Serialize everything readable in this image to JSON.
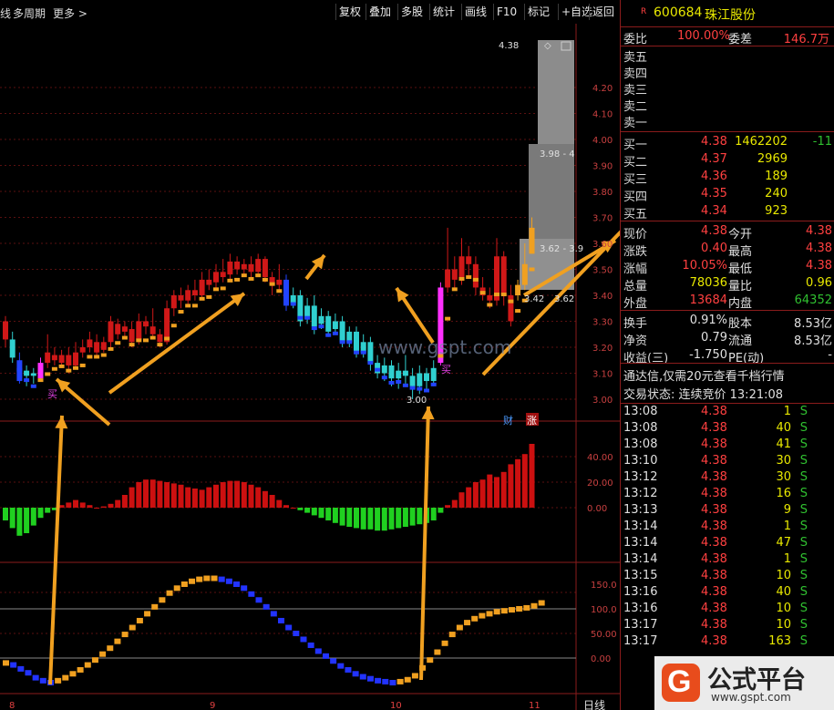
{
  "toolbar": {
    "left_items": [
      "线",
      "多周期",
      "更多 >"
    ],
    "buttons": [
      "复权",
      "叠加",
      "多股",
      "统计",
      "画线",
      "F10",
      "标记",
      "+自选",
      "返回"
    ]
  },
  "chart": {
    "price_ticks": [
      "4.20",
      "4.10",
      "4.00",
      "3.90",
      "3.80",
      "3.70",
      "3.60",
      "3.50",
      "3.40",
      "3.30",
      "3.20",
      "3.10",
      "3.00"
    ],
    "top_price_label": "4.38",
    "low_price_label": "3.00",
    "box_labels": [
      "3.98 - 4",
      "3.62 - 3.9",
      "3.42",
      "3.62"
    ],
    "buy_marker": "买",
    "badges": [
      "财",
      "涨"
    ],
    "watermark": "www.gspt.com",
    "macd_ticks": [
      "40.00",
      "20.00",
      "0.00"
    ],
    "osc_ticks": [
      "150.0",
      "100.0",
      "50.00",
      "0.00"
    ],
    "x_labels": [
      "8",
      "9",
      "10",
      "11"
    ],
    "x_axis_mode": "日线"
  },
  "panel": {
    "badge": "R",
    "code": "600684",
    "name": "珠江股份",
    "weibi_label": "委比",
    "weibi_value": "100.00%",
    "weicha_label": "委差",
    "weicha_value": "146.7万",
    "sell_levels": [
      "卖五",
      "卖四",
      "卖三",
      "卖二",
      "卖一"
    ],
    "buy_levels": [
      {
        "label": "买一",
        "price": "4.38",
        "vol": "1462202",
        "chg": "-11"
      },
      {
        "label": "买二",
        "price": "4.37",
        "vol": "2969",
        "chg": ""
      },
      {
        "label": "买三",
        "price": "4.36",
        "vol": "189",
        "chg": ""
      },
      {
        "label": "买四",
        "price": "4.35",
        "vol": "240",
        "chg": ""
      },
      {
        "label": "买五",
        "price": "4.34",
        "vol": "923",
        "chg": ""
      }
    ],
    "stats": [
      {
        "l1": "现价",
        "v1": "4.38",
        "l2": "今开",
        "v2": "4.38"
      },
      {
        "l1": "涨跌",
        "v1": "0.40",
        "l2": "最高",
        "v2": "4.38"
      },
      {
        "l1": "涨幅",
        "v1": "10.05%",
        "l2": "最低",
        "v2": "4.38"
      },
      {
        "l1": "总量",
        "v1": "78036",
        "l2": "量比",
        "v2": "0.96"
      },
      {
        "l1": "外盘",
        "v1": "13684",
        "l2": "内盘",
        "v2": "64352"
      }
    ],
    "stats2": [
      {
        "l1": "换手",
        "v1": "0.91%",
        "l2": "股本",
        "v2": "8.53亿"
      },
      {
        "l1": "净资",
        "v1": "0.79",
        "l2": "流通",
        "v2": "8.53亿"
      },
      {
        "l1": "收益(三)",
        "v1": "-1.750",
        "l2": "PE(动)",
        "v2": "-"
      }
    ],
    "promo": "通达信,仅需20元查看千档行情",
    "status_label": "交易状态: 连续竞价 13:21:08",
    "ticks": [
      {
        "t": "13:08",
        "p": "4.38",
        "v": "1",
        "s": "S"
      },
      {
        "t": "13:08",
        "p": "4.38",
        "v": "40",
        "s": "S"
      },
      {
        "t": "13:08",
        "p": "4.38",
        "v": "41",
        "s": "S"
      },
      {
        "t": "13:10",
        "p": "4.38",
        "v": "30",
        "s": "S"
      },
      {
        "t": "13:12",
        "p": "4.38",
        "v": "30",
        "s": "S"
      },
      {
        "t": "13:12",
        "p": "4.38",
        "v": "16",
        "s": "S"
      },
      {
        "t": "13:13",
        "p": "4.38",
        "v": "9",
        "s": "S"
      },
      {
        "t": "13:14",
        "p": "4.38",
        "v": "1",
        "s": "S"
      },
      {
        "t": "13:14",
        "p": "4.38",
        "v": "47",
        "s": "S"
      },
      {
        "t": "13:14",
        "p": "4.38",
        "v": "1",
        "s": "S"
      },
      {
        "t": "13:15",
        "p": "4.38",
        "v": "10",
        "s": "S"
      },
      {
        "t": "13:16",
        "p": "4.38",
        "v": "40",
        "s": "S"
      },
      {
        "t": "13:16",
        "p": "4.38",
        "v": "10",
        "s": "S"
      },
      {
        "t": "13:17",
        "p": "4.38",
        "v": "10",
        "s": "S"
      },
      {
        "t": "13:17",
        "p": "4.38",
        "v": "163",
        "s": "S"
      }
    ]
  },
  "logo": {
    "text": "公式平台",
    "url": "www.gspt.com"
  },
  "colors": {
    "up": "#e02020",
    "down": "#30d0d0",
    "up_bar": "#cc1010",
    "down_bar": "#20d020",
    "panel_border": "#8b1c1c",
    "arrow": "#f0a020"
  }
}
